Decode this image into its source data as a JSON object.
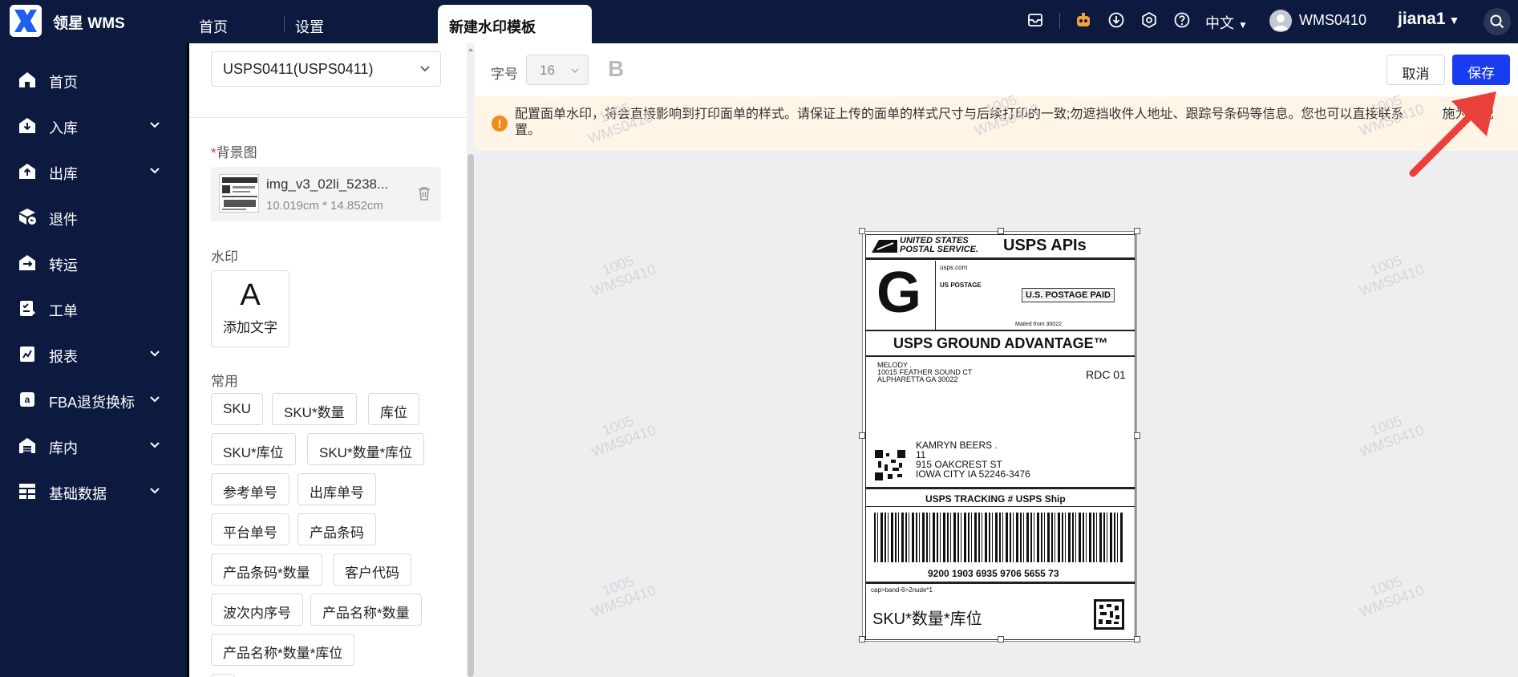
{
  "header": {
    "brand": "领星 WMS",
    "tabs": [
      "首页",
      "设置"
    ],
    "active_tab": "新建水印模板",
    "language": "中文",
    "account": "WMS0410",
    "username": "jiana1"
  },
  "sidebar": {
    "items": [
      {
        "label": "首页",
        "icon": "home-icon",
        "expandable": false
      },
      {
        "label": "入库",
        "icon": "inbound-icon",
        "expandable": true
      },
      {
        "label": "出库",
        "icon": "outbound-icon",
        "expandable": true
      },
      {
        "label": "退件",
        "icon": "return-icon",
        "expandable": false
      },
      {
        "label": "转运",
        "icon": "transfer-icon",
        "expandable": false
      },
      {
        "label": "工单",
        "icon": "workorder-icon",
        "expandable": false
      },
      {
        "label": "报表",
        "icon": "report-icon",
        "expandable": true
      },
      {
        "label": "FBA退货换标",
        "icon": "amazon-icon",
        "expandable": true
      },
      {
        "label": "库内",
        "icon": "warehouse-icon",
        "expandable": true
      },
      {
        "label": "基础数据",
        "icon": "data-icon",
        "expandable": true
      }
    ]
  },
  "panel": {
    "template_select": "USPS0411(USPS0411)",
    "background_label": "背景图",
    "required_mark": "*",
    "file_name": "img_v3_02li_5238...",
    "file_size": "10.019cm * 14.852cm",
    "watermark_label": "水印",
    "add_text_icon": "A",
    "add_text": "添加文字",
    "common_label": "常用",
    "chips": [
      "SKU",
      "SKU*数量",
      "库位",
      "SKU*库位",
      "SKU*数量*库位",
      "参考单号",
      "出库单号",
      "平台单号",
      "产品条码",
      "产品条码*数量",
      "客户代码",
      "波次内序号",
      "产品名称*数量",
      "产品名称*数量*库位"
    ]
  },
  "toolbar": {
    "font_size_label": "字号",
    "font_size_value": "16",
    "bold_label": "B",
    "cancel_label": "取消",
    "save_label": "保存"
  },
  "notice": {
    "text": "配置面单水印，将会直接影响到打印面单的样式。请保证上传的面单的样式尺寸与后续打印的一致;勿遮挡收件人地址、跟踪号条码等信息。您也可以直接联系　　　施为您配置。"
  },
  "watermark": {
    "line1": "1005",
    "line2": "WMS0410"
  },
  "shipping_label": {
    "carrier_line1": "UNITED STATES",
    "carrier_line2": "POSTAL SERVICE.",
    "service_header": "USPS APIs",
    "service_letter": "G",
    "usps_com": "usps.com",
    "us_postage": "US POSTAGE",
    "postage_paid": "U.S. POSTAGE PAID",
    "mailed_from": "Mailed from 30022",
    "service_name": "USPS GROUND ADVANTAGE™",
    "sender_line1": "MELODY .",
    "sender_line2": "10015 FEATHER SOUND CT",
    "sender_line3": "ALPHARETTA GA 30022",
    "route_code": "RDC 01",
    "recipient_line1": "KAMRYN BEERS .",
    "recipient_line2": "11",
    "recipient_line3": "915 OAKCREST ST",
    "recipient_line4": "IOWA CITY IA 52246-3476",
    "tracking_title": "USPS TRACKING # USPS Ship",
    "tracking_number": "9200 1903 6935 9706 5655 73",
    "footer_small": "cap>band-6>2nude*1",
    "watermark_text": "SKU*数量*库位"
  },
  "colors": {
    "header_bg": "#0d1a40",
    "accent": "#1a3cf0",
    "warning": "#f08c1a",
    "notice_bg": "#fff5e6",
    "annotation_arrow": "#e8413a"
  }
}
